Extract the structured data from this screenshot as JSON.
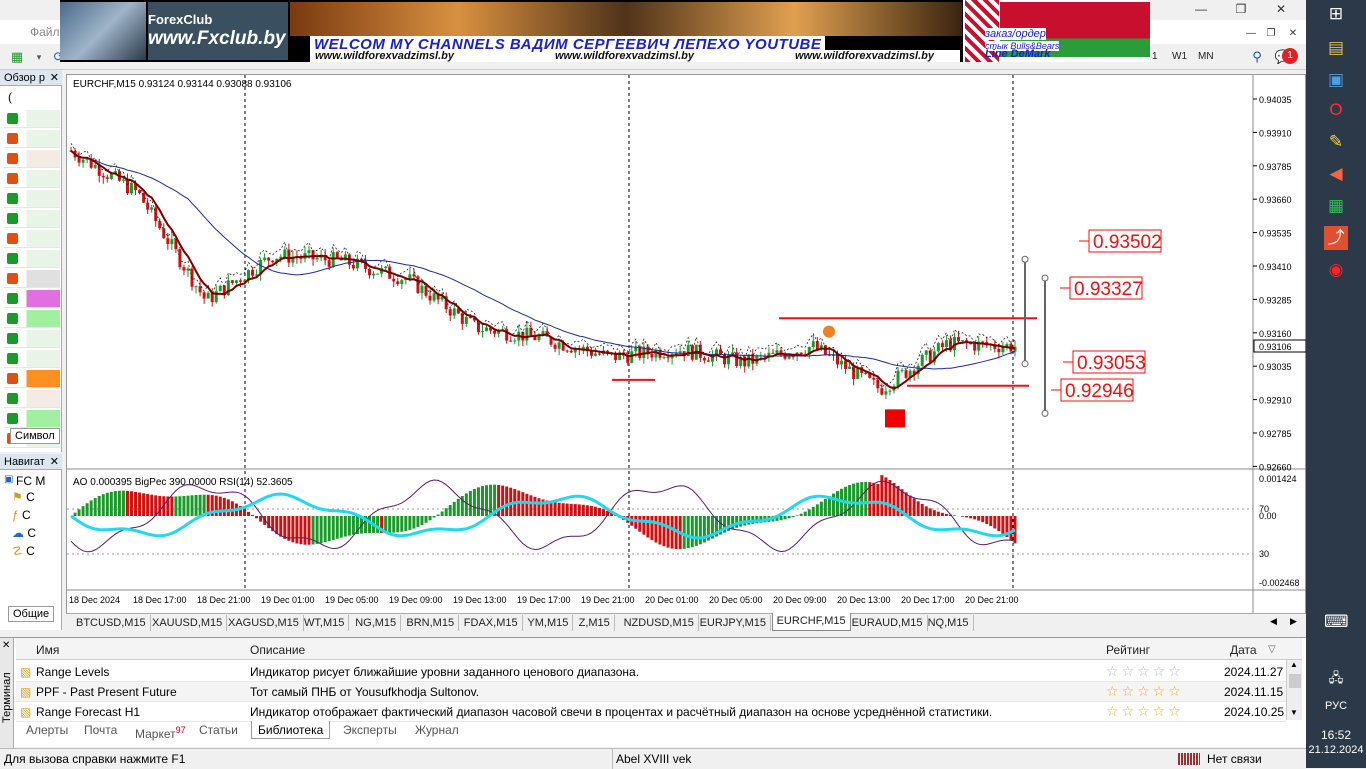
{
  "menu": {
    "file": "Файл"
  },
  "toolbar": {
    "w1": "W1",
    "mn": "MN",
    "notify_count": "1"
  },
  "banner": {
    "fx_logo": "ForexClub",
    "fx_url": "www.Fxclub.by",
    "welcome": "WELCOM MY CHANNELS ВАДИМ СЕРГЕЕВИЧ ЛЕПЕХО YOUTUBE",
    "url1": "www.wildforexvadzimsl.by",
    "url2": "www.wildforexvadzimsl.by",
    "url3": "www.wildforexvadzimsl.by",
    "order": "заказ/ордер",
    "bulls": "стык Bulls&Bears",
    "demark": "Line DeMark"
  },
  "market_watch": {
    "title": "Обзор р",
    "tab_symbols": "Символ",
    "first_row": "("
  },
  "navigator": {
    "title": "Навигат",
    "root": "FC M",
    "items": [
      "С",
      "С",
      "С",
      "С"
    ],
    "tab_common": "Общие"
  },
  "chart": {
    "info": "EURCHF,M15  0.93124 0.93144 0.93088 0.93106",
    "indicators": "AO 0.000395  BigPec 390.00000  RSI(14) 52.3605",
    "price_ticks": [
      "0.94035",
      "0.93910",
      "0.93785",
      "0.93660",
      "0.93535",
      "0.93410",
      "0.93285",
      "0.93160",
      "0.93035",
      "0.92910",
      "0.92785",
      "0.92660"
    ],
    "current_price": "0.93106",
    "sub_ticks": [
      "0.001424",
      "70",
      "0.00",
      "30",
      "-0.002468"
    ],
    "time_ticks": [
      "18 Dec 2024",
      "18 Dec 17:00",
      "18 Dec 21:00",
      "19 Dec 01:00",
      "19 Dec 05:00",
      "19 Dec 09:00",
      "19 Dec 13:00",
      "19 Dec 17:00",
      "19 Dec 21:00",
      "20 Dec 01:00",
      "20 Dec 05:00",
      "20 Dec 09:00",
      "20 Dec 13:00",
      "20 Dec 17:00",
      "20 Dec 21:00"
    ],
    "levels": [
      "0.93502",
      "0.93327",
      "0.93053",
      "0.92946"
    ]
  },
  "chart_data": {
    "type": "line",
    "title": "",
    "xlabel": "",
    "ylabel": "",
    "x": [
      "18 Dec 2024",
      "18 Dec 17:00",
      "18 Dec 21:00",
      "19 Dec 01:00",
      "19 Dec 05:00",
      "19 Dec 09:00",
      "19 Dec 13:00",
      "19 Dec 17:00",
      "19 Dec 21:00",
      "20 Dec 01:00",
      "20 Dec 05:00",
      "20 Dec 09:00",
      "20 Dec 13:00",
      "20 Dec 17:00",
      "20 Dec 21:00"
    ],
    "series": [
      {
        "values": [
          0.9384,
          0.9368,
          0.9328,
          0.9345,
          0.9343,
          0.9336,
          0.9318,
          0.9314,
          0.9307,
          0.931,
          0.9305,
          0.9311,
          0.9295,
          0.9312,
          0.9311
        ]
      }
    ],
    "ylim": [
      0.9266,
      0.941
    ],
    "grid": false
  },
  "symbol_tabs": [
    "BTCUSD,M15",
    "XAUUSD,M15",
    "XAGUSD,M15",
    "WT,M15",
    "NG,M15",
    "BRN,M15",
    "FDAX,M15",
    "YM,M15",
    "Z,M15",
    "NZDUSD,M15",
    "EURJPY,M15",
    "EURCHF,M15",
    "EURAUD,M15",
    "NQ,M15"
  ],
  "active_symbol_tab": "EURCHF,M15",
  "terminal": {
    "side_label": "Терминал",
    "col_name": "Имя",
    "col_desc": "Описание",
    "col_rating": "Рейтинг",
    "col_date": "Дата",
    "rows": [
      {
        "name": "Range Levels",
        "desc": "Индикатор рисует ближайшие уровни заданного ценового диапазона.",
        "date": "2024.11.27"
      },
      {
        "name": "PPF - Past Present Future",
        "desc": "Тот самый ПНБ от Yousufkhodja Sultonov.",
        "date": "2024.11.15"
      },
      {
        "name": "Range Forecast H1",
        "desc": "Индикатор отображает фактический диапазон часовой свечи в процентах и расчётный диапазон на основе усреднённой статистики.",
        "date": "2024.10.25"
      }
    ],
    "tabs": [
      "Алерты",
      "Почта",
      "Маркет",
      "Статьи",
      "Библиотека",
      "Эксперты",
      "Журнал"
    ],
    "market_badge": "97",
    "active_tab": "Библиотека"
  },
  "status": {
    "help": "Для вызова справки нажмите F1",
    "profile": "Abel XVIII vek",
    "connection": "Нет связи"
  },
  "taskbar": {
    "lang": "РУС",
    "time": "16:52",
    "date": "21.12.2024"
  },
  "colors": {
    "up": "#1a9a2a",
    "down": "#cc1111",
    "ma_blue": "#1c2a9c",
    "ma_dark": "#7a0000",
    "rsi": "#22d8f0",
    "level_red": "#ee1111"
  }
}
